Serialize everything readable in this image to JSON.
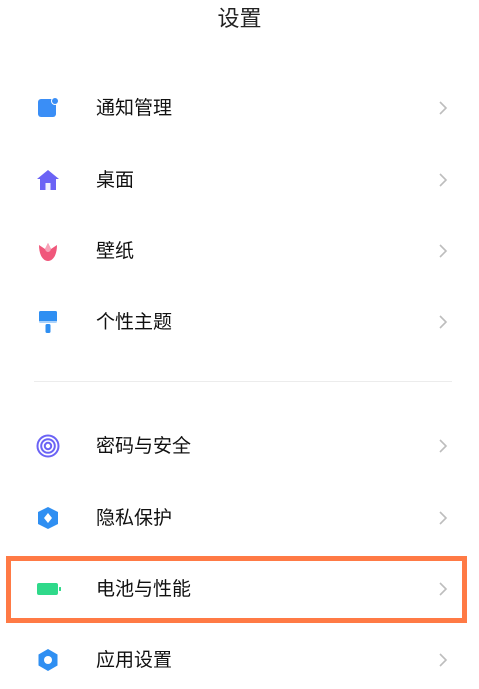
{
  "header": {
    "title": "设置"
  },
  "group1": [
    {
      "label": "通知管理",
      "icon": "notification-icon",
      "color": "#3a8ef6"
    },
    {
      "label": "桌面",
      "icon": "home-icon",
      "color": "#6b63f5"
    },
    {
      "label": "壁纸",
      "icon": "tulip-icon",
      "color": "#f0577b"
    },
    {
      "label": "个性主题",
      "icon": "paint-brush-icon",
      "color": "#2f8ff2"
    }
  ],
  "group2": [
    {
      "label": "密码与安全",
      "icon": "fingerprint-icon",
      "color": "#6b63f5"
    },
    {
      "label": "隐私保护",
      "icon": "shield-icon",
      "color": "#2f8ff2"
    },
    {
      "label": "电池与性能",
      "icon": "battery-icon",
      "color": "#2fd98a",
      "highlighted": true
    },
    {
      "label": "应用设置",
      "icon": "gear-icon",
      "color": "#2f8ff2"
    }
  ],
  "highlight_color": "#ff7a45"
}
